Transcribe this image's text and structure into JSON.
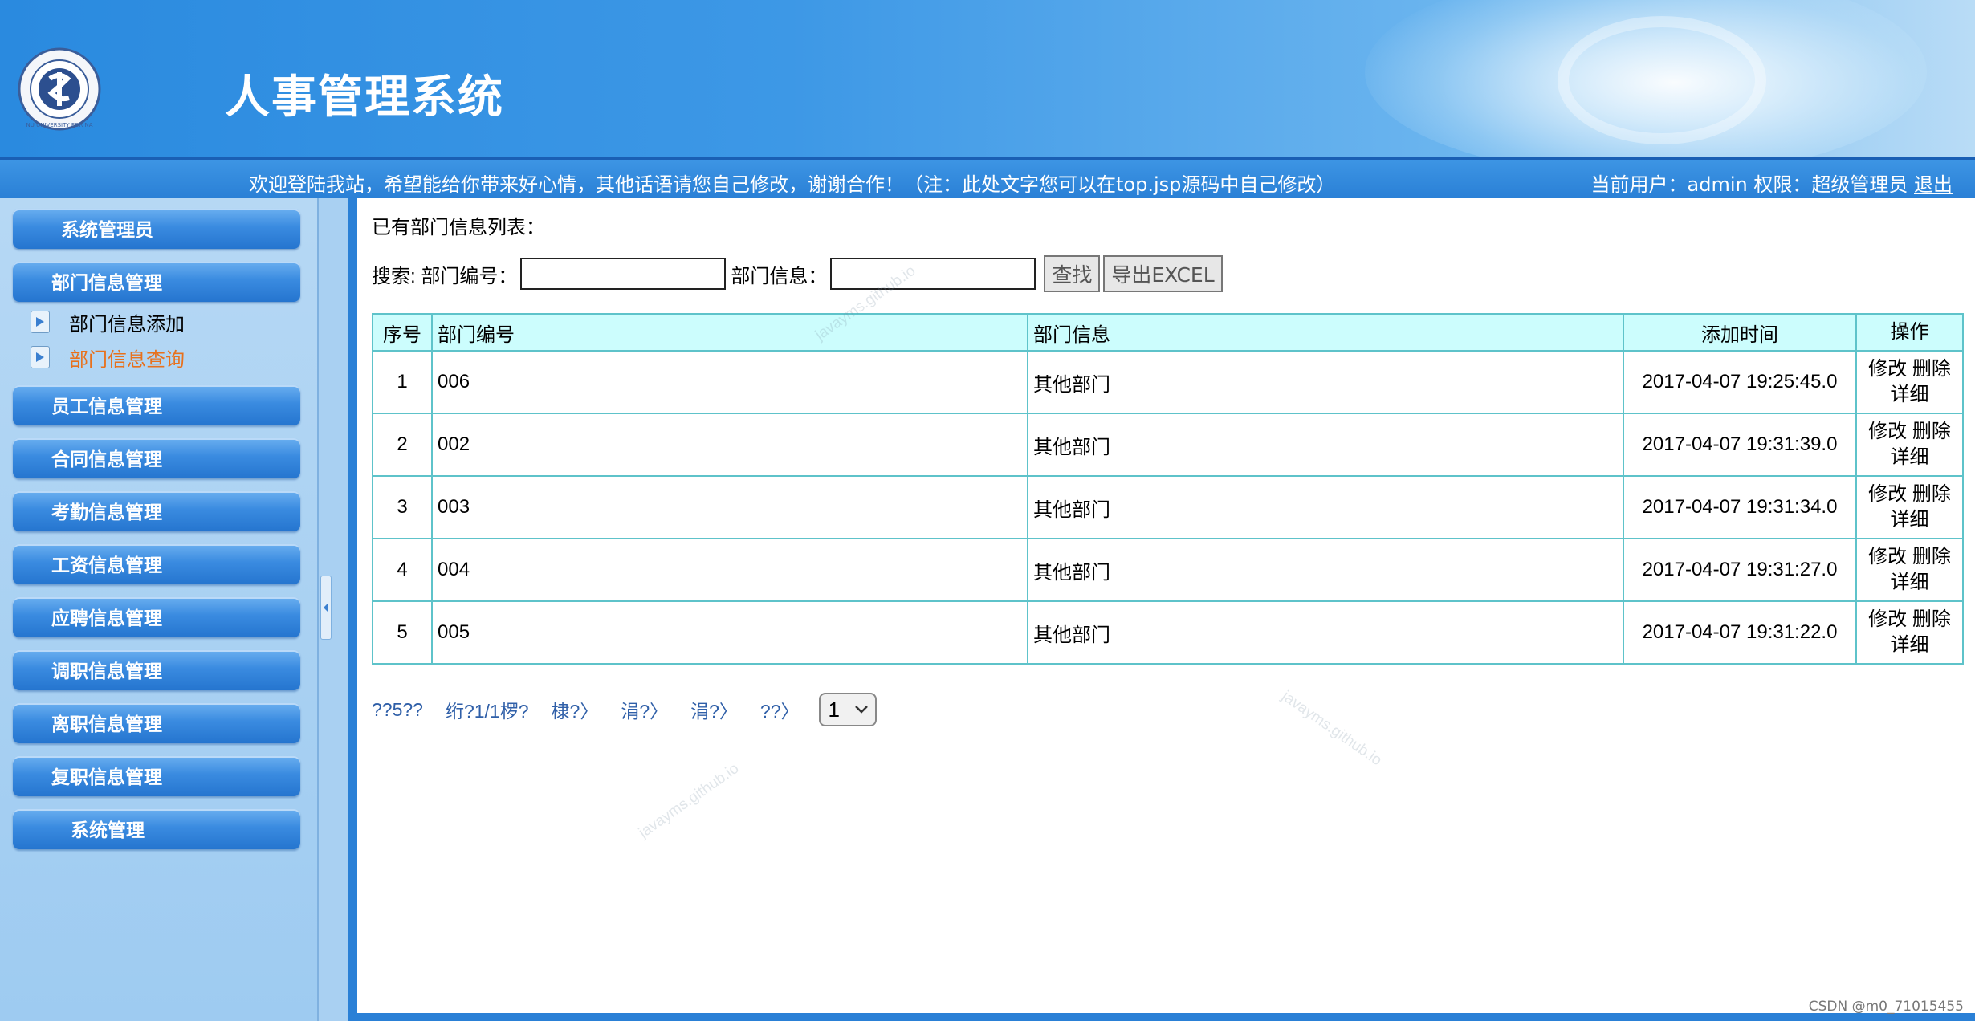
{
  "header": {
    "title": "人事管理系统",
    "logo_text": "NU UNIVERSITY FOR NA"
  },
  "info_bar": {
    "welcome": "欢迎登陆我站，希望能给你带来好心情，其他话语请您自己修改，谢谢合作！（注：此处文字您可以在top.jsp源码中自己修改）",
    "user_label": "当前用户：admin 权限：超级管理员",
    "logout": "退出"
  },
  "sidebar": {
    "items": [
      {
        "label": "系统管理员"
      },
      {
        "label": "部门信息管理"
      },
      {
        "label": "员工信息管理"
      },
      {
        "label": "合同信息管理"
      },
      {
        "label": "考勤信息管理"
      },
      {
        "label": "工资信息管理"
      },
      {
        "label": "应聘信息管理"
      },
      {
        "label": "调职信息管理"
      },
      {
        "label": "离职信息管理"
      },
      {
        "label": "复职信息管理"
      },
      {
        "label": "系统管理"
      }
    ],
    "submenu": [
      {
        "label": "部门信息添加",
        "active": false
      },
      {
        "label": "部门信息查询",
        "active": true
      }
    ]
  },
  "content": {
    "list_title": "已有部门信息列表：",
    "search": {
      "prefix": "搜索: 部门编号：",
      "info_label": "部门信息：",
      "code_value": "",
      "info_value": "",
      "find_button": "查找",
      "export_button": "导出EXCEL"
    },
    "table": {
      "headers": [
        "序号",
        "部门编号",
        "部门信息",
        "添加时间",
        "操作"
      ],
      "rows": [
        {
          "idx": "1",
          "code": "006",
          "info": "其他部门",
          "time": "2017-04-07 19:25:45.0"
        },
        {
          "idx": "2",
          "code": "002",
          "info": "其他部门",
          "time": "2017-04-07 19:31:39.0"
        },
        {
          "idx": "3",
          "code": "003",
          "info": "其他部门",
          "time": "2017-04-07 19:31:34.0"
        },
        {
          "idx": "4",
          "code": "004",
          "info": "其他部门",
          "time": "2017-04-07 19:31:27.0"
        },
        {
          "idx": "5",
          "code": "005",
          "info": "其他部门",
          "time": "2017-04-07 19:31:22.0"
        }
      ],
      "ops": {
        "edit": "修改",
        "delete": "删除",
        "detail": "详细"
      }
    },
    "pagination": {
      "total": "??5??",
      "page_info": "绗?1/1椤?",
      "first": "棣?〉",
      "prev": "涓?〉",
      "next": "涓?〉",
      "last": "??〉",
      "selected_page": "1"
    }
  },
  "watermark": "javayms.github.io",
  "csdn_mark": "CSDN @m0_71015455",
  "colors": {
    "banner": "#2a8adf",
    "active_menu": "#e8711c",
    "table_border": "#5ec3ca",
    "table_header_bg": "#ccfdfd",
    "link": "#2f5fa8"
  }
}
